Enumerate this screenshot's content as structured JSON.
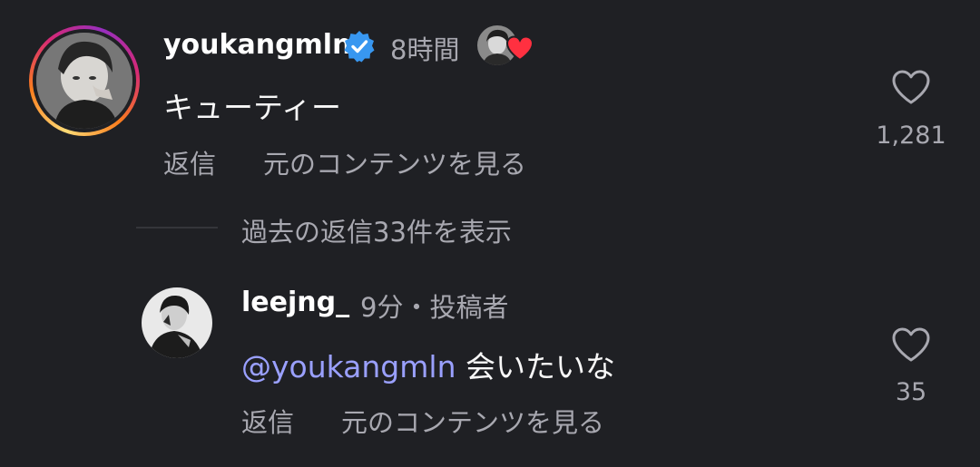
{
  "main_comment": {
    "username": "youkangmln",
    "time": "8時間",
    "text": "キューティー",
    "like_count": "1,281",
    "reply_label": "返信",
    "see_original_label": "元のコンテンツを見る",
    "verified_icon": "verified-badge-icon",
    "liked_by_creator": true
  },
  "view_replies": {
    "label": "過去の返信33件を表示"
  },
  "reply_comment": {
    "username": "leejng_",
    "meta": "9分・投稿者",
    "mention": "@youkangmln",
    "text": " 会いたいな",
    "like_count": "35",
    "reply_label": "返信",
    "see_original_label": "元のコンテンツを見る"
  },
  "colors": {
    "background": "#1f2024",
    "verified_blue": "#3897f0",
    "mention": "#9aa0ff",
    "muted_text": "#a8a8b0",
    "heart_red": "#ff3040"
  }
}
